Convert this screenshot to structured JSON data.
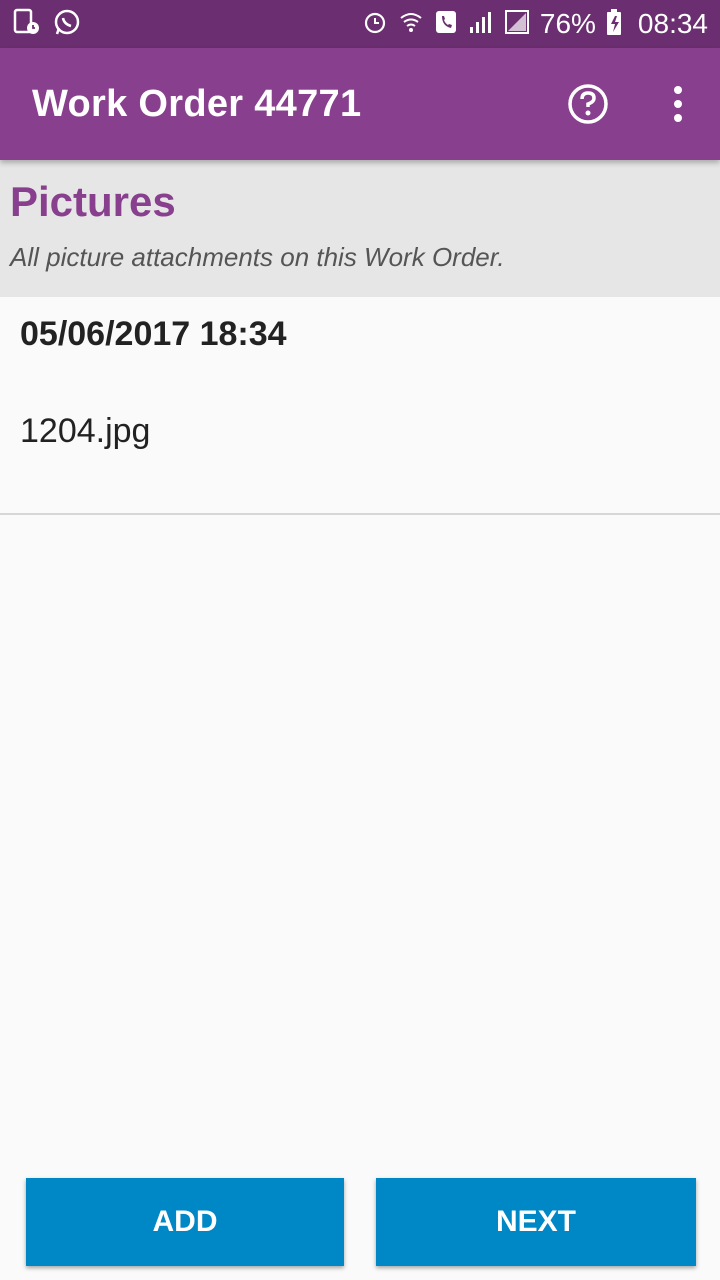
{
  "status_bar": {
    "left_icons": [
      "sim-icon",
      "whatsapp-icon"
    ],
    "right_icons": [
      "alarm-icon",
      "wifi-call-icon",
      "phone-icon",
      "signal-icon",
      "signal-empty-icon",
      "battery-charging-icon"
    ],
    "battery_percent": "76%",
    "time": "08:34"
  },
  "app_bar": {
    "title": "Work Order 44771",
    "help_icon": "help-circle-icon",
    "menu_icon": "more-vert-icon"
  },
  "section": {
    "heading": "Pictures",
    "subheading": "All picture attachments on this Work Order."
  },
  "pictures": [
    {
      "date": "05/06/2017 18:34",
      "filename": "1204.jpg"
    }
  ],
  "buttons": {
    "add_label": "ADD",
    "next_label": "NEXT"
  },
  "colors": {
    "status_bar": "#6b2e70",
    "app_bar": "#883f8d",
    "accent_heading": "#883f8d",
    "button": "#0087c5"
  }
}
